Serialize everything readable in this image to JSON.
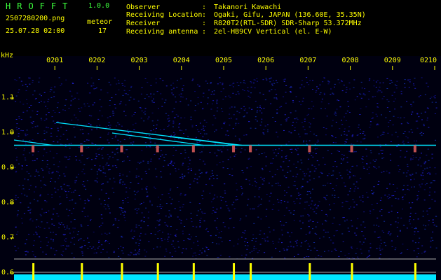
{
  "header": {
    "brand": "HROFFT",
    "version": "1.0.0",
    "filename": "2507280200.png",
    "datetime": "25.07.28 02:00",
    "meteor_label": "meteor",
    "meteor_count": "17"
  },
  "info": {
    "observer_label": "Observer",
    "observer_value": "Takanori Kawachi",
    "location_label": "Receiving Location",
    "location_value": "Ogaki, Gifu, JAPAN (136.60E, 35.35N)",
    "receiver_label": "Receiver",
    "receiver_value": "R820T2(RTL-SDR) SDR-Sharp 53.372MHz",
    "antenna_label": "Receiving antenna",
    "antenna_value": "2el-HB9CV Vertical (el. E-W)",
    "colon": ":"
  },
  "colors": {
    "background": "#000000",
    "label_yellow": "#ffff00",
    "brand_green": "#3cff3c",
    "noise_blue": "#1a1ab0",
    "trace_cyan": "#00e5ff",
    "trace_yellow": "#ffff00"
  },
  "chart_data": {
    "type": "heatmap",
    "title": "",
    "ylabel": "kHz",
    "xlabel": "",
    "x_ticks": [
      "0201",
      "0202",
      "0203",
      "0204",
      "0205",
      "0206",
      "0207",
      "0208",
      "0209",
      "0210"
    ],
    "y_ticks": [
      "1.1",
      "1.0",
      "0.9",
      "0.8",
      "0.7",
      "0.6"
    ],
    "ylim": [
      0.58,
      1.16
    ],
    "xlim_minutes": [
      0,
      10
    ],
    "carrier_khz": 0.965,
    "meteor_echo_minutes": [
      0.45,
      1.6,
      2.55,
      3.4,
      4.25,
      5.2,
      5.6,
      7.0,
      8.0,
      9.5
    ]
  }
}
